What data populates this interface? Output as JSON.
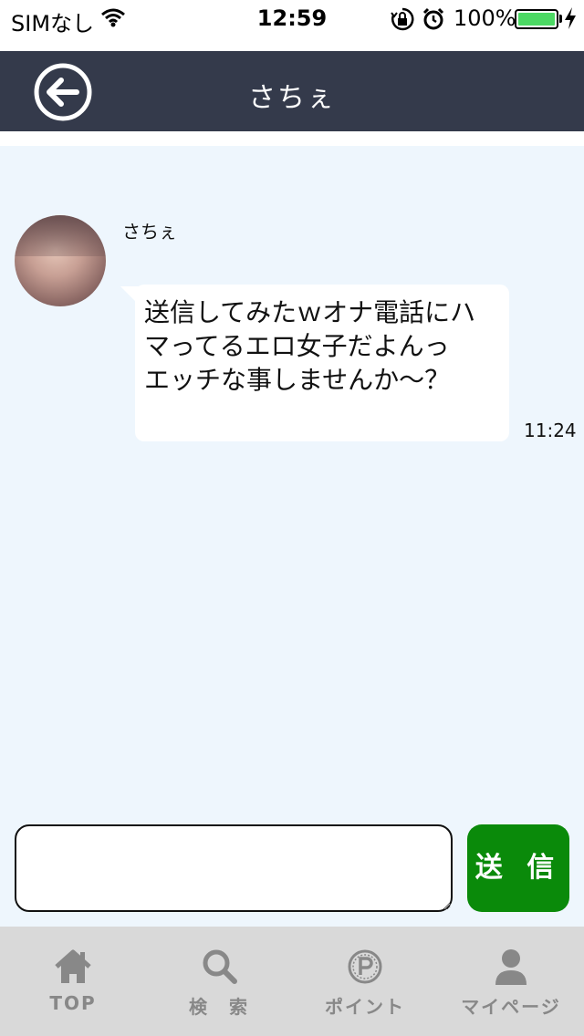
{
  "status_bar": {
    "carrier": "SIMなし",
    "time": "12:59",
    "battery_percent": "100%",
    "battery_level": 1.0,
    "icons": [
      "wifi-icon",
      "orientation-lock-icon",
      "alarm-icon",
      "battery-icon",
      "charging-icon"
    ]
  },
  "header": {
    "title": "さちぇ",
    "back_icon": "back-arrow-circle-icon",
    "background_color": "#343a4b"
  },
  "chat": {
    "messages": [
      {
        "sender": "さちぇ",
        "text": "送信してみたｗオナ電話にハ\nマってるエロ女子だよんっ\nエッチな事しませんか～？",
        "time": "11:24"
      }
    ],
    "background_color": "#eef6fd"
  },
  "composer": {
    "input_value": "",
    "send_label": "送 信",
    "send_color": "#0a8a0a"
  },
  "tab_bar": {
    "tabs": [
      {
        "label": "TOP",
        "icon": "home-icon"
      },
      {
        "label": "検　索",
        "icon": "search-icon"
      },
      {
        "label": "ポイント",
        "icon": "points-icon"
      },
      {
        "label": "マイページ",
        "icon": "user-icon"
      }
    ]
  }
}
